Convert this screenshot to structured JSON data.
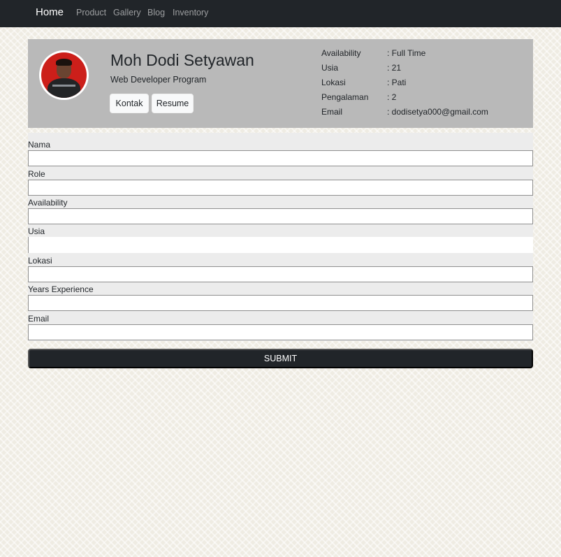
{
  "navbar": {
    "brand": "Home",
    "links": [
      "Product",
      "Gallery",
      "Blog",
      "Inventory"
    ]
  },
  "profile": {
    "name": "Moh Dodi Setyawan",
    "program": "Web Developer Program",
    "buttons": [
      "Kontak",
      "Resume"
    ],
    "details": [
      {
        "label": "Availability",
        "value": ": Full Time"
      },
      {
        "label": "Usia",
        "value": ": 21"
      },
      {
        "label": "Lokasi",
        "value": ": Pati"
      },
      {
        "label": "Pengalaman",
        "value": ": 2"
      },
      {
        "label": "Email",
        "value": ": dodisetya000@gmail.com"
      }
    ]
  },
  "form": {
    "fields": [
      {
        "label": "Nama",
        "value": ""
      },
      {
        "label": "Role",
        "value": ""
      },
      {
        "label": "Availability",
        "value": ""
      },
      {
        "label": "Usia",
        "value": ""
      },
      {
        "label": "Lokasi",
        "value": ""
      },
      {
        "label": "Years Experience",
        "value": ""
      },
      {
        "label": "Email",
        "value": ""
      }
    ],
    "submit_label": "SUBMIT"
  },
  "colors": {
    "navbar_bg": "#212529",
    "profile_bg": "#b9b9b9",
    "form_bg": "#ececec",
    "submit_bg": "#212529"
  }
}
